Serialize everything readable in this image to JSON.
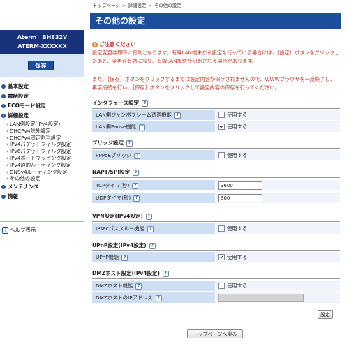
{
  "sidebar": {
    "brand_line1": "Aterm　BH832V",
    "brand_line2": "ATERM-XXXXXX",
    "save_label": "保存",
    "main_items": [
      {
        "label": "基本設定"
      },
      {
        "label": "電話設定"
      },
      {
        "label": "ECOモード設定"
      },
      {
        "label": "詳細設定"
      }
    ],
    "sub_items": [
      {
        "label": "LAN側設定(IPv4設定)"
      },
      {
        "label": "DHCPv4除外設定"
      },
      {
        "label": "DHCPv4固定割当設定"
      },
      {
        "label": "IPv4パケットフィルタ設定"
      },
      {
        "label": "IPv6パケットフィルタ設定"
      },
      {
        "label": "IPv4ポートマッピング設定"
      },
      {
        "label": "IPv4静的ルーティング設定"
      },
      {
        "label": "DNSv4ルーティング設定"
      },
      {
        "label": "その他の設定"
      }
    ],
    "bottom_items": [
      {
        "label": "メンテナンス"
      },
      {
        "label": "情報"
      }
    ],
    "help_label": "ヘルプ表示"
  },
  "breadcrumb": {
    "items": [
      "トップページ",
      "詳細設定",
      "その他の設定"
    ],
    "separator": ">"
  },
  "page_title": "その他の設定",
  "notice": {
    "heading": "ご注意ください",
    "para1": "設定変更は即時に有効となります。有線LAN端末から設定を行っている場合には、［設定］ボタンをクリックしたあと、変更が有効になり、有線LAN接続が切断される場合があります。",
    "para2": "また、［保存］ボタンをクリックするまでは設定内容が保存されませんので、WWWブラウザを一度終了し、再度接続を行い、［保存］ボタンをクリックして設定内容の保存を行ってください。"
  },
  "sections": {
    "interface": {
      "title": "インタフェース設定",
      "jumbo_label": "LAN側ジャンボフレーム透過機能",
      "jumbo_value": "使用する",
      "pause_label": "LAN側Pause機能",
      "pause_value": "使用する"
    },
    "bridge": {
      "title": "ブリッジ設定",
      "pppoe_label": "PPPoEブリッジ",
      "pppoe_value": "使用する"
    },
    "napt": {
      "title": "NAPT/SPI設定",
      "tcp_label": "TCPタイマ(秒)",
      "tcp_value": "3600",
      "udp_label": "UDPタイマ(秒)",
      "udp_value": "300"
    },
    "vpn": {
      "title": "VPN設定(IPv4設定)",
      "ipsec_label": "IPsecパススルー機能",
      "ipsec_value": "使用する"
    },
    "upnp": {
      "title": "UPnP設定(IPv4設定)",
      "upnp_label": "UPnP機能",
      "upnp_value": "使用する"
    },
    "dmz": {
      "title": "DMZホスト設定(IPv4設定)",
      "dmz_label": "DMZホスト機能",
      "dmz_value": "使用する",
      "ip_label": "DMZホストのIPアドレス",
      "ip_value": ""
    }
  },
  "checkbox_state": {
    "jumbo": false,
    "pause": true,
    "pppoe": false,
    "ipsec": false,
    "upnp": true,
    "dmz": false
  },
  "buttons": {
    "set_label": "設定",
    "top_label": "トップページへ戻る"
  },
  "help_icon": "?",
  "colors": {
    "brand": "#19337a",
    "title_bar": "#1d4e9e",
    "notice_text": "#c0392b",
    "label_bg": "#cfdff3"
  }
}
